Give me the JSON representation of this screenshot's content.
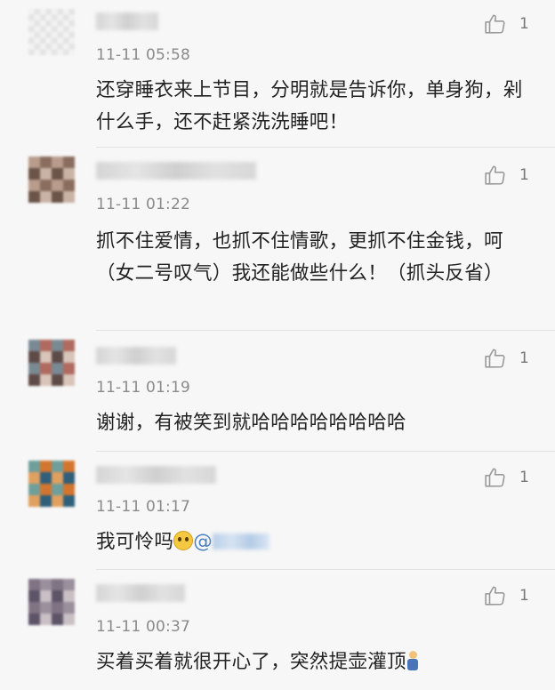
{
  "comments": [
    {
      "time": "11-11 05:58",
      "text": "还穿睡衣来上节目，分明就是告诉你，单身狗，剁什么手，还不赶紧洗洗睡吧！",
      "likes": "1",
      "avatar_colors": [
        "#e6e6e6",
        "#f3f3f3",
        "#d9d9d9",
        "#eeeeee"
      ]
    },
    {
      "time": "11-11 01:22",
      "text": "抓不住爱情，也抓不住情歌，更抓不住金钱，呵（女二号叹气）我还能做些什么！（抓头反省）",
      "likes": "1",
      "avatar_colors": [
        "#8a6d5e",
        "#b89c8c",
        "#6b5448",
        "#c9b3a5"
      ]
    },
    {
      "time": "11-11 01:19",
      "text": "谢谢，有被笑到就哈哈哈哈哈哈哈哈",
      "likes": "1",
      "avatar_colors": [
        "#b06a5f",
        "#7a8a93",
        "#d8c4b8",
        "#5e4a47"
      ]
    },
    {
      "time": "11-11 01:17",
      "text_main": "我可怜吗",
      "mention_at": "@",
      "likes": "1",
      "avatar_colors": [
        "#d4752f",
        "#6f9f9a",
        "#2f5f7a",
        "#e0a060"
      ]
    },
    {
      "time": "11-11 00:37",
      "text": "买着买着就很开心了，突然提壶灌顶",
      "likes": "1",
      "avatar_colors": [
        "#9a8f9c",
        "#5d5468",
        "#c9bfc4",
        "#7f7384"
      ]
    }
  ],
  "icons": {
    "like": "thumbs-up-icon",
    "emoji_1": "pleading-face-emoji",
    "emoji_2": "person-emoji"
  }
}
